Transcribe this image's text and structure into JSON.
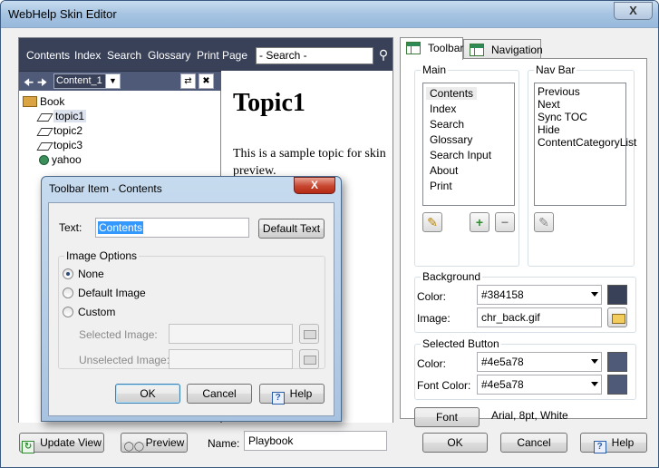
{
  "window": {
    "title": "WebHelp Skin Editor",
    "close_label": "X"
  },
  "preview": {
    "toolbar_items": [
      "Contents",
      "Index",
      "Search",
      "Glossary",
      "Print Page"
    ],
    "search_placeholder": "- Search -",
    "search_icon": "search-icon",
    "nav_select_value": "Content_1",
    "tree": {
      "book": "Book",
      "topics": [
        "topic1",
        "topic2",
        "topic3"
      ],
      "extra": "yahoo"
    },
    "topic_title": "Topic1",
    "topic_body": "This is a sample topic for skin preview.",
    "toolbar_bg": "#384158",
    "nav_bg": "#4e5a78"
  },
  "tabs": [
    {
      "label": "Toolbar",
      "active": true
    },
    {
      "label": "Navigation",
      "active": false
    }
  ],
  "main_group": {
    "label": "Main",
    "items": [
      "Contents",
      "Index",
      "Search",
      "Glossary",
      "Search Input",
      "About",
      "Print"
    ],
    "selected": "Contents"
  },
  "navbar_group": {
    "label": "Nav Bar",
    "items": [
      "Previous",
      "Next",
      "Sync TOC",
      "Hide",
      "ContentCategoryList"
    ]
  },
  "background": {
    "label": "Background",
    "color_label": "Color:",
    "color_value": "#384158",
    "image_label": "Image:",
    "image_value": "chr_back.gif"
  },
  "selected_button": {
    "label": "Selected Button",
    "color_label": "Color:",
    "color_value": "#4e5a78",
    "font_color_label": "Font Color:",
    "font_color_value": "#4e5a78"
  },
  "font": {
    "button_label": "Font",
    "description": "Arial, 8pt, White"
  },
  "bottom": {
    "update_view": "Update View",
    "preview": "Preview",
    "name_label": "Name:",
    "name_value": "Playbook",
    "ok": "OK",
    "cancel": "Cancel",
    "help": "Help"
  },
  "dialog": {
    "title": "Toolbar Item - Contents",
    "close_label": "X",
    "text_label": "Text:",
    "text_value": "Contents",
    "default_text": "Default Text",
    "image_options_label": "Image Options",
    "options": [
      "None",
      "Default Image",
      "Custom"
    ],
    "selected_option": "None",
    "selected_image_label": "Selected Image:",
    "unselected_image_label": "Unselected Image:",
    "ok": "OK",
    "cancel": "Cancel",
    "help": "Help"
  }
}
